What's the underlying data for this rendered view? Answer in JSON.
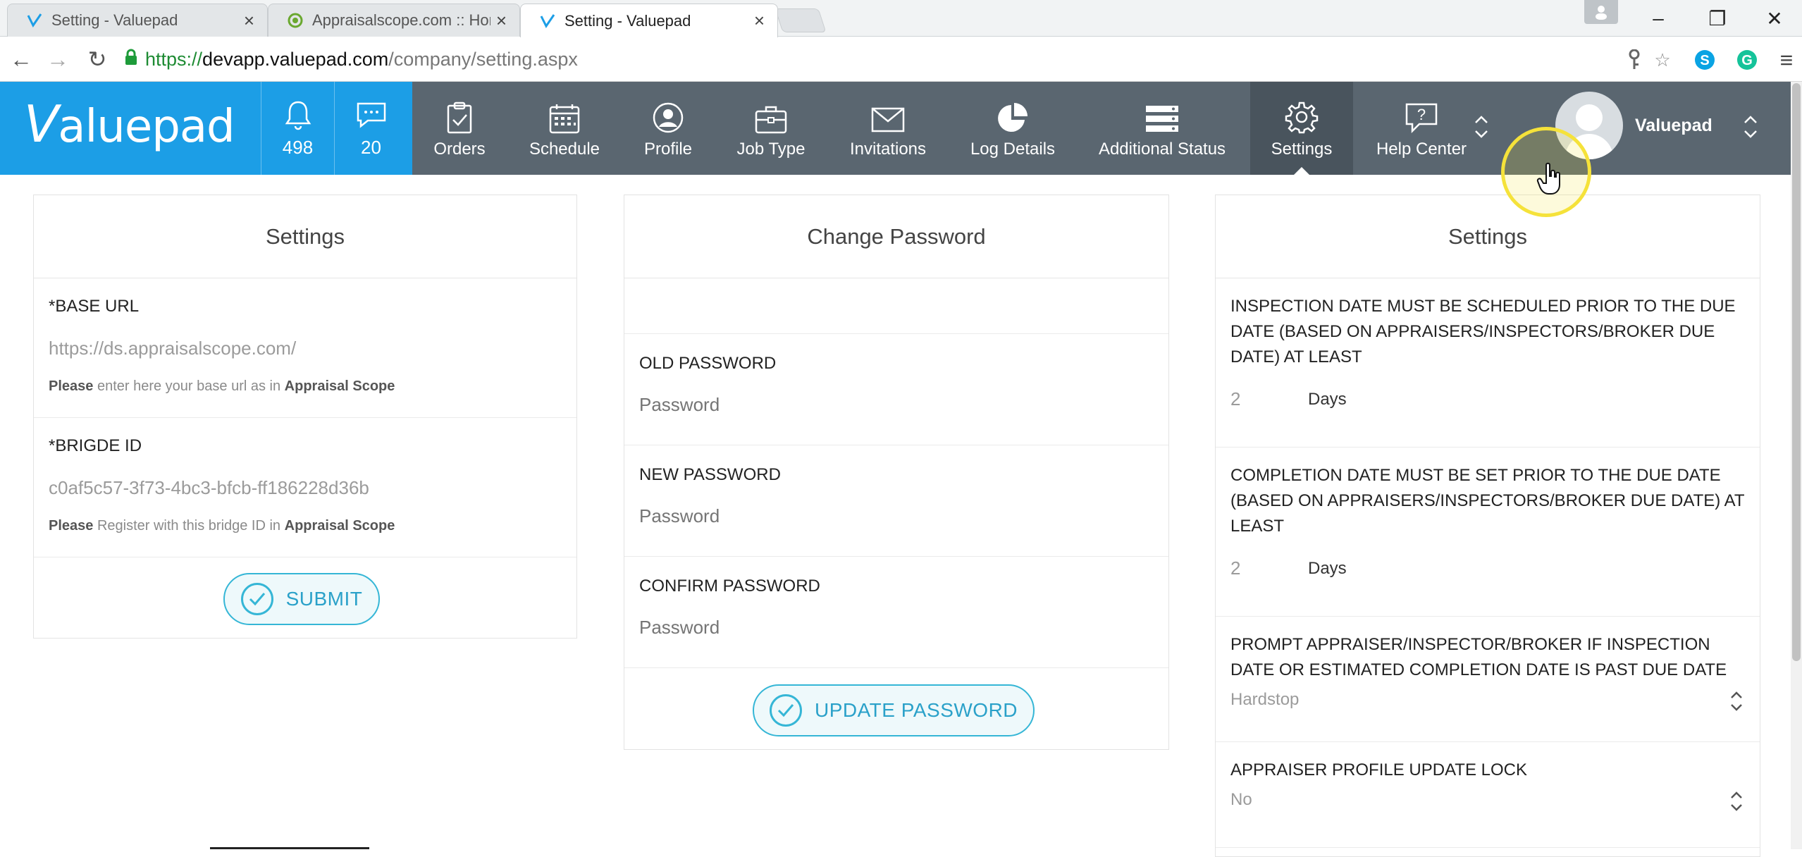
{
  "browser": {
    "tabs": [
      {
        "title": "Setting - Valuepad",
        "close": "×"
      },
      {
        "title": "Appraisalscope.com :: Hor",
        "close": "×"
      },
      {
        "title": "Setting - Valuepad",
        "close": "×"
      }
    ],
    "window_controls": {
      "minimize": "–",
      "restore": "❐",
      "close": "✕"
    },
    "nav": {
      "back": "←",
      "forward": "→",
      "reload": "↻"
    },
    "url": {
      "secure": "https://",
      "host": "devapp.valuepad.com",
      "path": "/company/setting.aspx"
    },
    "menu_icon": "≡"
  },
  "header": {
    "brand": "aluepad",
    "brand_mark": "V",
    "notifications_count": "498",
    "messages_count": "20",
    "nav_items": [
      {
        "label": "Orders"
      },
      {
        "label": "Schedule"
      },
      {
        "label": "Profile"
      },
      {
        "label": "Job Type"
      },
      {
        "label": "Invitations"
      },
      {
        "label": "Log Details"
      },
      {
        "label": "Additional Status"
      },
      {
        "label": "Settings"
      },
      {
        "label": "Help Center"
      }
    ],
    "user_name": "Valuepad"
  },
  "left_panel": {
    "title": "Settings",
    "base_url_label": "*BASE URL",
    "base_url_value": "https://ds.appraisalscope.com/",
    "base_url_hint_prefix": "Please",
    "base_url_hint_mid": " enter here your base url as in ",
    "base_url_hint_brand": "Appraisal Scope",
    "bridge_label": "*BRIGDE ID",
    "bridge_value": "c0af5c57-3f73-4bc3-bfcb-ff186228d36b",
    "bridge_hint_prefix": "Please",
    "bridge_hint_mid": " Register with this bridge ID in ",
    "bridge_hint_brand": "Appraisal Scope",
    "submit_label": "SUBMIT"
  },
  "middle_panel": {
    "title": "Change Password",
    "old_label": "OLD PASSWORD",
    "old_placeholder": "Password",
    "new_label": "NEW PASSWORD",
    "new_placeholder": "Password",
    "confirm_label": "CONFIRM PASSWORD",
    "confirm_placeholder": "Password",
    "update_label": "UPDATE PASSWORD"
  },
  "right_panel": {
    "title": "Settings",
    "inspection_label": "INSPECTION DATE MUST BE SCHEDULED PRIOR TO THE DUE DATE (BASED ON APPRAISERS/INSPECTORS/BROKER DUE DATE) AT LEAST",
    "inspection_days": "2",
    "inspection_unit": "Days",
    "completion_label": "COMPLETION DATE MUST BE SET PRIOR TO THE DUE DATE (BASED ON APPRAISERS/INSPECTORS/BROKER DUE DATE) AT LEAST",
    "completion_days": "2",
    "completion_unit": "Days",
    "prompt_label": "PROMPT APPRAISER/INSPECTOR/BROKER IF INSPECTION DATE OR ESTIMATED COMPLETION DATE IS PAST DUE DATE",
    "prompt_value": "Hardstop",
    "lock_label": "APPRAISER PROFILE UPDATE LOCK",
    "lock_value": "No"
  },
  "colors": {
    "brand_blue": "#1c9ee6",
    "header_gray": "#5a6670",
    "accent_teal": "#35b6d6"
  }
}
